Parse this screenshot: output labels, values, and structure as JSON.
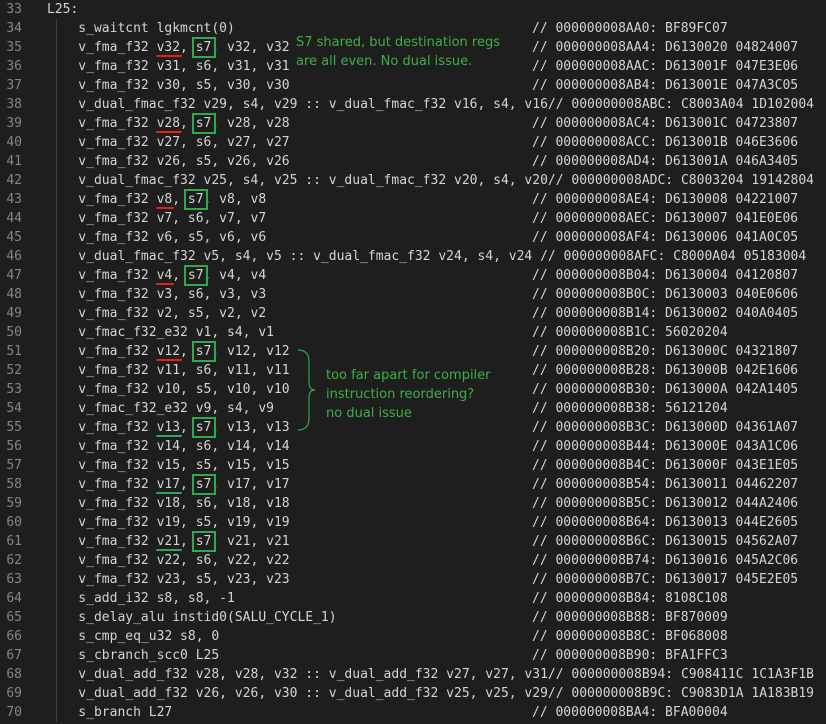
{
  "lines": [
    {
      "n": "33",
      "code": "L25:",
      "cmt": ""
    },
    {
      "n": "34",
      "code": "    s_waitcnt lgkmcnt(0)",
      "cmt": "// 000000008AA0: BF89FC07"
    },
    {
      "n": "35",
      "code": "    v_fma_f32 v32, s7, v32, v32",
      "cmt": "// 000000008AA4: D6130020 04824007"
    },
    {
      "n": "36",
      "code": "    v_fma_f32 v31, s6, v31, v31",
      "cmt": "// 000000008AAC: D613001F 047E3E06"
    },
    {
      "n": "37",
      "code": "    v_fma_f32 v30, s5, v30, v30",
      "cmt": "// 000000008AB4: D613001E 047A3C05"
    },
    {
      "n": "38",
      "code": "    v_dual_fmac_f32 v29, s4, v29 :: v_dual_fmac_f32 v16, s4, v16// 000000008ABC: C8003A04 1D102004",
      "cmt": ""
    },
    {
      "n": "39",
      "code": "    v_fma_f32 v28, s7, v28, v28",
      "cmt": "// 000000008AC4: D613001C 04723807"
    },
    {
      "n": "40",
      "code": "    v_fma_f32 v27, s6, v27, v27",
      "cmt": "// 000000008ACC: D613001B 046E3606"
    },
    {
      "n": "41",
      "code": "    v_fma_f32 v26, s5, v26, v26",
      "cmt": "// 000000008AD4: D613001A 046A3405"
    },
    {
      "n": "42",
      "code": "    v_dual_fmac_f32 v25, s4, v25 :: v_dual_fmac_f32 v20, s4, v20// 000000008ADC: C8003204 19142804",
      "cmt": ""
    },
    {
      "n": "43",
      "code": "    v_fma_f32 v8, s7, v8, v8",
      "cmt": "// 000000008AE4: D6130008 04221007"
    },
    {
      "n": "44",
      "code": "    v_fma_f32 v7, s6, v7, v7",
      "cmt": "// 000000008AEC: D6130007 041E0E06"
    },
    {
      "n": "45",
      "code": "    v_fma_f32 v6, s5, v6, v6",
      "cmt": "// 000000008AF4: D6130006 041A0C05"
    },
    {
      "n": "46",
      "code": "    v_dual_fmac_f32 v5, s4, v5 :: v_dual_fmac_f32 v24, s4, v24 // 000000008AFC: C8000A04 05183004",
      "cmt": ""
    },
    {
      "n": "47",
      "code": "    v_fma_f32 v4, s7, v4, v4",
      "cmt": "// 000000008B04: D6130004 04120807"
    },
    {
      "n": "48",
      "code": "    v_fma_f32 v3, s6, v3, v3",
      "cmt": "// 000000008B0C: D6130003 040E0606"
    },
    {
      "n": "49",
      "code": "    v_fma_f32 v2, s5, v2, v2",
      "cmt": "// 000000008B14: D6130002 040A0405"
    },
    {
      "n": "50",
      "code": "    v_fmac_f32_e32 v1, s4, v1",
      "cmt": "// 000000008B1C: 56020204"
    },
    {
      "n": "51",
      "code": "    v_fma_f32 v12, s7, v12, v12",
      "cmt": "// 000000008B20: D613000C 04321807"
    },
    {
      "n": "52",
      "code": "    v_fma_f32 v11, s6, v11, v11",
      "cmt": "// 000000008B28: D613000B 042E1606"
    },
    {
      "n": "53",
      "code": "    v_fma_f32 v10, s5, v10, v10",
      "cmt": "// 000000008B30: D613000A 042A1405"
    },
    {
      "n": "54",
      "code": "    v_fmac_f32_e32 v9, s4, v9",
      "cmt": "// 000000008B38: 56121204"
    },
    {
      "n": "55",
      "code": "    v_fma_f32 v13, s7, v13, v13",
      "cmt": "// 000000008B3C: D613000D 04361A07"
    },
    {
      "n": "56",
      "code": "    v_fma_f32 v14, s6, v14, v14",
      "cmt": "// 000000008B44: D613000E 043A1C06"
    },
    {
      "n": "57",
      "code": "    v_fma_f32 v15, s5, v15, v15",
      "cmt": "// 000000008B4C: D613000F 043E1E05"
    },
    {
      "n": "58",
      "code": "    v_fma_f32 v17, s7, v17, v17",
      "cmt": "// 000000008B54: D6130011 04462207"
    },
    {
      "n": "59",
      "code": "    v_fma_f32 v18, s6, v18, v18",
      "cmt": "// 000000008B5C: D6130012 044A2406"
    },
    {
      "n": "60",
      "code": "    v_fma_f32 v19, s5, v19, v19",
      "cmt": "// 000000008B64: D6130013 044E2605"
    },
    {
      "n": "61",
      "code": "    v_fma_f32 v21, s7, v21, v21",
      "cmt": "// 000000008B6C: D6130015 04562A07"
    },
    {
      "n": "62",
      "code": "    v_fma_f32 v22, s6, v22, v22",
      "cmt": "// 000000008B74: D6130016 045A2C06"
    },
    {
      "n": "63",
      "code": "    v_fma_f32 v23, s5, v23, v23",
      "cmt": "// 000000008B7C: D6130017 045E2E05"
    },
    {
      "n": "64",
      "code": "    s_add_i32 s8, s8, -1",
      "cmt": "// 000000008B84: 8108C108"
    },
    {
      "n": "65",
      "code": "    s_delay_alu instid0(SALU_CYCLE_1)",
      "cmt": "// 000000008B88: BF870009"
    },
    {
      "n": "66",
      "code": "    s_cmp_eq_u32 s8, 0",
      "cmt": "// 000000008B8C: BF068008"
    },
    {
      "n": "67",
      "code": "    s_cbranch_scc0 L25",
      "cmt": "// 000000008B90: BFA1FFC3"
    },
    {
      "n": "68",
      "code": "    v_dual_add_f32 v28, v28, v32 :: v_dual_add_f32 v27, v27, v31// 000000008B94: C908411C 1C1A3F1B",
      "cmt": ""
    },
    {
      "n": "69",
      "code": "    v_dual_add_f32 v26, v26, v30 :: v_dual_add_f32 v25, v25, v29// 000000008B9C: C9083D1A 1A183B19",
      "cmt": ""
    },
    {
      "n": "70",
      "code": "    s_branch L27",
      "cmt": "// 000000008BA4: BFA00004"
    }
  ],
  "notes": {
    "top": "S7 shared, but destination regs\nare all even. No dual issue.",
    "middle": "too far apart for compiler\ninstruction reordering?\nno dual issue"
  },
  "colors": {
    "background": "#1e1e1e",
    "text": "#d4d4d4",
    "line_numbers": "#858585",
    "note_green": "#3cb043",
    "underline_red": "#e5201c",
    "highlight_green": "#2fa84f"
  }
}
